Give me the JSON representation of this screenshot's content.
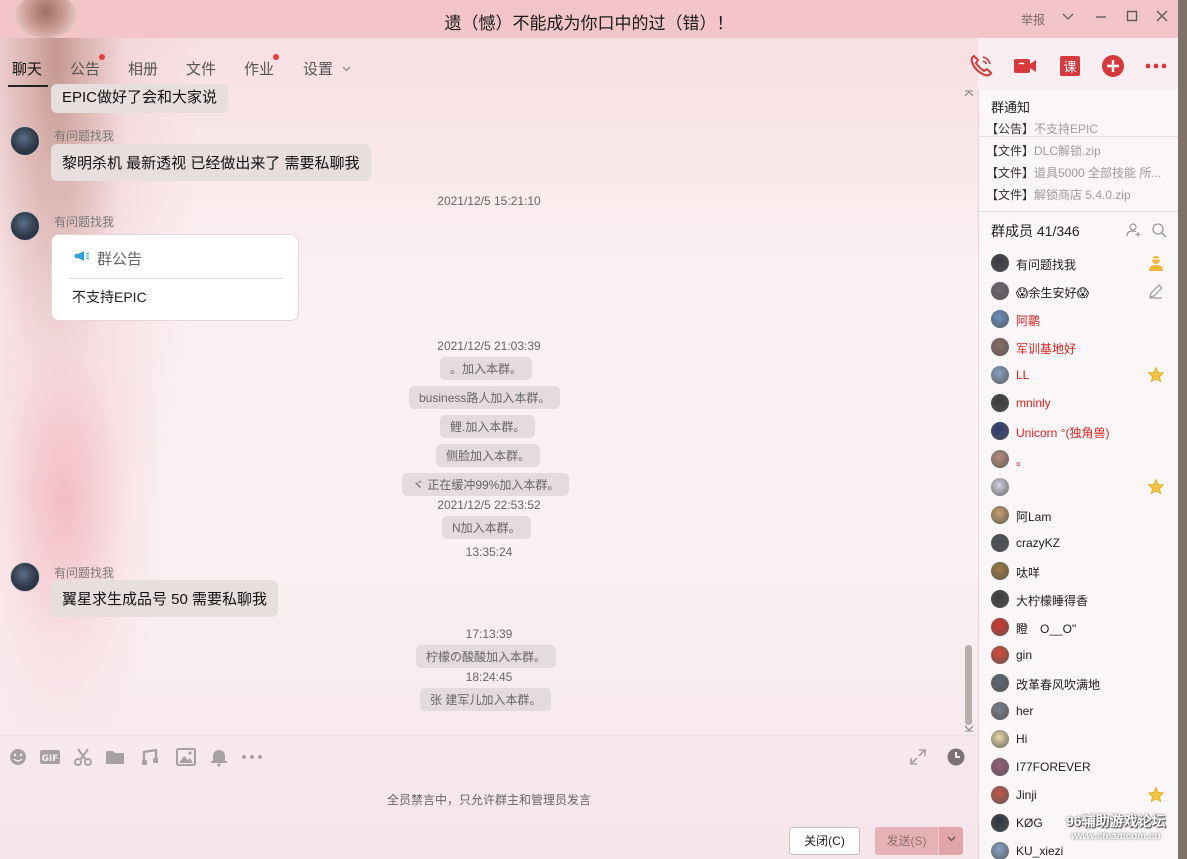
{
  "window": {
    "title": "遗（憾）不能成为你口中的过（错）！",
    "report_label": "举报"
  },
  "tabs": [
    {
      "label": "聊天",
      "active": true,
      "dot": false
    },
    {
      "label": "公告",
      "active": false,
      "dot": true
    },
    {
      "label": "相册",
      "active": false,
      "dot": false
    },
    {
      "label": "文件",
      "active": false,
      "dot": false
    },
    {
      "label": "作业",
      "active": false,
      "dot": true
    },
    {
      "label": "设置",
      "active": false,
      "dot": false
    }
  ],
  "toolbar_icons": [
    "phone-call-icon",
    "video-call-icon",
    "class-icon",
    "add-app-icon",
    "more-icon"
  ],
  "toolbar_class_label": "课",
  "chat": {
    "partial_top_message": "EPIC做好了会和大家说",
    "messages": [
      {
        "sender": "有问题找我",
        "text": "黎明杀机 最新透视 已经做出来了 需要私聊我"
      },
      {
        "timestamp": "2021/12/5 15:21:10"
      },
      {
        "sender": "有问题找我",
        "card_title": "群公告",
        "card_body": "不支持EPIC"
      },
      {
        "timestamp": "2021/12/5 21:03:39"
      },
      {
        "system": "。加入本群。"
      },
      {
        "system": "business路人加入本群。"
      },
      {
        "system": "鲤.加入本群。"
      },
      {
        "system": "侧脸加入本群。"
      },
      {
        "system": "ヾ 正在缓冲99%加入本群。"
      },
      {
        "timestamp": "2021/12/5 22:53:52"
      },
      {
        "system": "N加入本群。"
      },
      {
        "timestamp": "13:35:24"
      },
      {
        "sender": "有问题找我",
        "text": "翼星求生成品号 50 需要私聊我"
      },
      {
        "timestamp": "17:13:39"
      },
      {
        "system": "柠檬の酸酸加入本群。"
      },
      {
        "timestamp": "18:24:45"
      },
      {
        "system": "张 建军儿加入本群。"
      }
    ]
  },
  "input": {
    "tools": [
      "emoji-icon",
      "gif-icon",
      "scissors-icon",
      "folder-icon",
      "music-icon",
      "image-icon",
      "bell-icon",
      "more-dots-icon"
    ],
    "gif_label": "GIF",
    "mute_notice": "全员禁言中，只允许群主和管理员发言",
    "close_button": "关闭(C)",
    "send_button": "发送(S)"
  },
  "sidebar": {
    "notice_title": "群通知",
    "notices": [
      {
        "prefix": "【公告】",
        "text": "不支持EPIC",
        "muted": true
      },
      {
        "prefix": "【文件】",
        "text": "DLC解锁.zip",
        "muted": true
      },
      {
        "prefix": "【文件】",
        "text": "道具5000 全部技能 所...",
        "muted": true
      },
      {
        "prefix": "【文件】",
        "text": "解锁商店 5.4.0.zip",
        "muted": true
      }
    ],
    "members_title": "群成员 41/346",
    "members": [
      {
        "name": "有问题找我",
        "red": false,
        "badge": "owner-icon",
        "color": "#3a3a44"
      },
      {
        "name": "😱余生安好😱",
        "red": false,
        "badge": "edit-icon",
        "color": "#6d6670"
      },
      {
        "name": "阿鹴",
        "red": true,
        "badge": "",
        "color": "#6a8fbf"
      },
      {
        "name": "军训基地好",
        "red": true,
        "badge": "",
        "color": "#8a6d64"
      },
      {
        "name": "LL",
        "red": true,
        "badge": "star-icon",
        "color": "#8aa2c0"
      },
      {
        "name": "mninly",
        "red": true,
        "badge": "",
        "color": "#3b3b3b"
      },
      {
        "name": "Unicorn °(独角兽)",
        "red": true,
        "badge": "",
        "color": "#2c3f74"
      },
      {
        "name": "。",
        "red": true,
        "badge": "",
        "color": "#b88c7a"
      },
      {
        "name": "",
        "red": false,
        "badge": "star-icon",
        "color": "#d9d3e6"
      },
      {
        "name": "阿Lam",
        "red": false,
        "badge": "",
        "color": "#c79f6c"
      },
      {
        "name": "crazyKZ",
        "red": false,
        "badge": "",
        "color": "#4b4f58"
      },
      {
        "name": "呔咩",
        "red": false,
        "badge": "",
        "color": "#a07a43"
      },
      {
        "name": "大柠檬睡得香",
        "red": false,
        "badge": "",
        "color": "#3d3d3d"
      },
      {
        "name": "瞪　O__O\"",
        "red": false,
        "badge": "",
        "color": "#d8322e"
      },
      {
        "name": "gin",
        "red": false,
        "badge": "",
        "color": "#d84a3a"
      },
      {
        "name": "改革春风吹满地",
        "red": false,
        "badge": "",
        "color": "#5b6570"
      },
      {
        "name": "her",
        "red": false,
        "badge": "",
        "color": "#7a7f8a"
      },
      {
        "name": "Hi",
        "red": false,
        "badge": "",
        "color": "#e9d9a6"
      },
      {
        "name": "I77FOREVER",
        "red": false,
        "badge": "",
        "color": "#9a5f79"
      },
      {
        "name": "Jinji",
        "red": false,
        "badge": "star-icon",
        "color": "#c55a4a"
      },
      {
        "name": "KØG",
        "red": false,
        "badge": "",
        "color": "#2e3440"
      },
      {
        "name": "KU_xiezi",
        "red": false,
        "badge": "",
        "color": "#8aa0c9"
      }
    ]
  },
  "watermark": {
    "line1": "96辅助游戏论坛",
    "line2": "www.steamcom.cn"
  },
  "colors": {
    "titlebar": "#f2c6c9",
    "accent_red": "#d63a3c",
    "member_red": "#e0231f",
    "send_button": "#e6b2b5"
  }
}
